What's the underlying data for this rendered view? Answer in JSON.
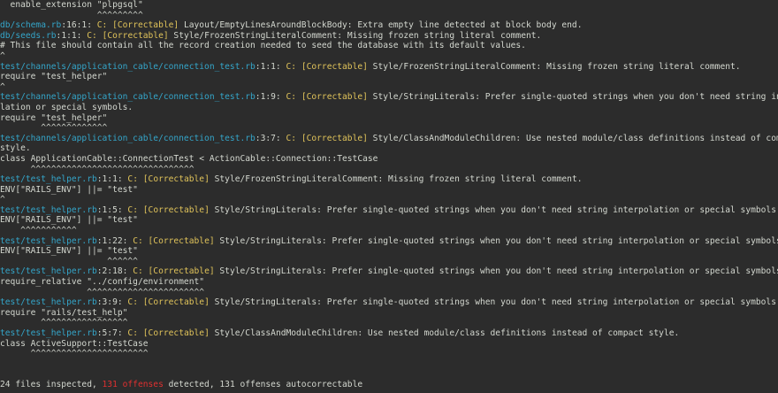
{
  "terminal": {
    "lines": [
      {
        "kind": "code",
        "text": "  enable_extension \"plpgsql\""
      },
      {
        "kind": "caret",
        "text": "                   ^^^^^^^^^"
      },
      {
        "kind": "offense",
        "path": "db/schema.rb",
        "loc": ":16:1:",
        "sev": "C:",
        "corr": "[Correctable]",
        "msg": " Layout/EmptyLinesAroundBlockBody: Extra empty line detected at block body end."
      },
      {
        "kind": "offense",
        "path": "db/seeds.rb",
        "loc": ":1:1:",
        "sev": "C:",
        "corr": "[Correctable]",
        "msg": " Style/FrozenStringLiteralComment: Missing frozen string literal comment."
      },
      {
        "kind": "code",
        "text": "# This file should contain all the record creation needed to seed the database with its default values."
      },
      {
        "kind": "caret",
        "text": "^"
      },
      {
        "kind": "offense",
        "path": "test/channels/application_cable/connection_test.rb",
        "loc": ":1:1:",
        "sev": "C:",
        "corr": "[Correctable]",
        "msg": " Style/FrozenStringLiteralComment: Missing frozen string literal comment."
      },
      {
        "kind": "code",
        "text": "require \"test_helper\""
      },
      {
        "kind": "caret",
        "text": "^"
      },
      {
        "kind": "offense",
        "path": "test/channels/application_cable/connection_test.rb",
        "loc": ":1:9:",
        "sev": "C:",
        "corr": "[Correctable]",
        "msg": " Style/StringLiterals: Prefer single-quoted strings when you don't need string interpo"
      },
      {
        "kind": "code",
        "text": "lation or special symbols."
      },
      {
        "kind": "code",
        "text": "require \"test_helper\""
      },
      {
        "kind": "caret",
        "text": "        ^^^^^^^^^^^^^"
      },
      {
        "kind": "offense",
        "path": "test/channels/application_cable/connection_test.rb",
        "loc": ":3:7:",
        "sev": "C:",
        "corr": "[Correctable]",
        "msg": " Style/ClassAndModuleChildren: Use nested module/class definitions instead of compact"
      },
      {
        "kind": "code",
        "text": "style."
      },
      {
        "kind": "code",
        "text": "class ApplicationCable::ConnectionTest < ActionCable::Connection::TestCase"
      },
      {
        "kind": "caret",
        "text": "      ^^^^^^^^^^^^^^^^^^^^^^^^^^^^^^^^"
      },
      {
        "kind": "offense",
        "path": "test/test_helper.rb",
        "loc": ":1:1:",
        "sev": "C:",
        "corr": "[Correctable]",
        "msg": " Style/FrozenStringLiteralComment: Missing frozen string literal comment."
      },
      {
        "kind": "code",
        "text": "ENV[\"RAILS_ENV\"] ||= \"test\""
      },
      {
        "kind": "caret",
        "text": "^"
      },
      {
        "kind": "offense",
        "path": "test/test_helper.rb",
        "loc": ":1:5:",
        "sev": "C:",
        "corr": "[Correctable]",
        "msg": " Style/StringLiterals: Prefer single-quoted strings when you don't need string interpolation or special symbols."
      },
      {
        "kind": "code",
        "text": "ENV[\"RAILS_ENV\"] ||= \"test\""
      },
      {
        "kind": "caret",
        "text": "    ^^^^^^^^^^^"
      },
      {
        "kind": "offense",
        "path": "test/test_helper.rb",
        "loc": ":1:22:",
        "sev": "C:",
        "corr": "[Correctable]",
        "msg": " Style/StringLiterals: Prefer single-quoted strings when you don't need string interpolation or special symbols."
      },
      {
        "kind": "code",
        "text": "ENV[\"RAILS_ENV\"] ||= \"test\""
      },
      {
        "kind": "caret",
        "text": "                     ^^^^^^"
      },
      {
        "kind": "offense",
        "path": "test/test_helper.rb",
        "loc": ":2:18:",
        "sev": "C:",
        "corr": "[Correctable]",
        "msg": " Style/StringLiterals: Prefer single-quoted strings when you don't need string interpolation or special symbols."
      },
      {
        "kind": "code",
        "text": "require_relative \"../config/environment\""
      },
      {
        "kind": "caret",
        "text": "                 ^^^^^^^^^^^^^^^^^^^^^^^"
      },
      {
        "kind": "offense",
        "path": "test/test_helper.rb",
        "loc": ":3:9:",
        "sev": "C:",
        "corr": "[Correctable]",
        "msg": " Style/StringLiterals: Prefer single-quoted strings when you don't need string interpolation or special symbols."
      },
      {
        "kind": "code",
        "text": "require \"rails/test_help\""
      },
      {
        "kind": "caret",
        "text": "        ^^^^^^^^^^^^^^^^^"
      },
      {
        "kind": "offense",
        "path": "test/test_helper.rb",
        "loc": ":5:7:",
        "sev": "C:",
        "corr": "[Correctable]",
        "msg": " Style/ClassAndModuleChildren: Use nested module/class definitions instead of compact style."
      },
      {
        "kind": "code",
        "text": "class ActiveSupport::TestCase"
      },
      {
        "kind": "caret",
        "text": "      ^^^^^^^^^^^^^^^^^^^^^^^"
      },
      {
        "kind": "blank",
        "text": ""
      },
      {
        "kind": "blank",
        "text": ""
      }
    ],
    "summary": {
      "prefix": "24 files inspected, ",
      "offenses": "131 offenses",
      "middle": " detected, ",
      "autocorrectable": "131 offenses",
      "suffix": " autocorrectable"
    }
  },
  "colors": {
    "background": "#2c2c2c",
    "text": "#d3d7cf",
    "path": "#34a5c9",
    "severity": "#e0c35a",
    "error": "#e03030"
  }
}
